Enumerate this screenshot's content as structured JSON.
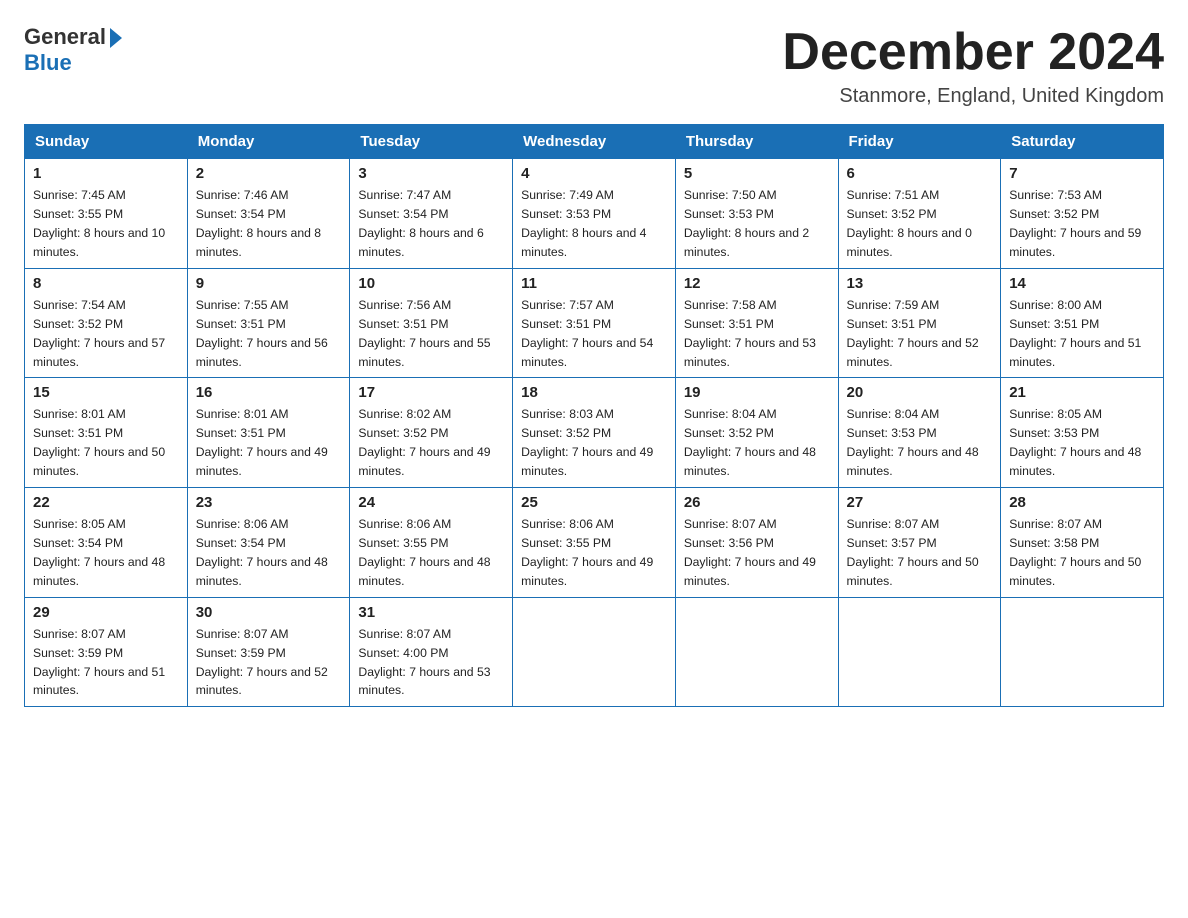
{
  "header": {
    "logo_general": "General",
    "logo_blue": "Blue",
    "title": "December 2024",
    "location": "Stanmore, England, United Kingdom"
  },
  "weekdays": [
    "Sunday",
    "Monday",
    "Tuesday",
    "Wednesday",
    "Thursday",
    "Friday",
    "Saturday"
  ],
  "weeks": [
    [
      {
        "day": "1",
        "sunrise": "7:45 AM",
        "sunset": "3:55 PM",
        "daylight": "8 hours and 10 minutes."
      },
      {
        "day": "2",
        "sunrise": "7:46 AM",
        "sunset": "3:54 PM",
        "daylight": "8 hours and 8 minutes."
      },
      {
        "day": "3",
        "sunrise": "7:47 AM",
        "sunset": "3:54 PM",
        "daylight": "8 hours and 6 minutes."
      },
      {
        "day": "4",
        "sunrise": "7:49 AM",
        "sunset": "3:53 PM",
        "daylight": "8 hours and 4 minutes."
      },
      {
        "day": "5",
        "sunrise": "7:50 AM",
        "sunset": "3:53 PM",
        "daylight": "8 hours and 2 minutes."
      },
      {
        "day": "6",
        "sunrise": "7:51 AM",
        "sunset": "3:52 PM",
        "daylight": "8 hours and 0 minutes."
      },
      {
        "day": "7",
        "sunrise": "7:53 AM",
        "sunset": "3:52 PM",
        "daylight": "7 hours and 59 minutes."
      }
    ],
    [
      {
        "day": "8",
        "sunrise": "7:54 AM",
        "sunset": "3:52 PM",
        "daylight": "7 hours and 57 minutes."
      },
      {
        "day": "9",
        "sunrise": "7:55 AM",
        "sunset": "3:51 PM",
        "daylight": "7 hours and 56 minutes."
      },
      {
        "day": "10",
        "sunrise": "7:56 AM",
        "sunset": "3:51 PM",
        "daylight": "7 hours and 55 minutes."
      },
      {
        "day": "11",
        "sunrise": "7:57 AM",
        "sunset": "3:51 PM",
        "daylight": "7 hours and 54 minutes."
      },
      {
        "day": "12",
        "sunrise": "7:58 AM",
        "sunset": "3:51 PM",
        "daylight": "7 hours and 53 minutes."
      },
      {
        "day": "13",
        "sunrise": "7:59 AM",
        "sunset": "3:51 PM",
        "daylight": "7 hours and 52 minutes."
      },
      {
        "day": "14",
        "sunrise": "8:00 AM",
        "sunset": "3:51 PM",
        "daylight": "7 hours and 51 minutes."
      }
    ],
    [
      {
        "day": "15",
        "sunrise": "8:01 AM",
        "sunset": "3:51 PM",
        "daylight": "7 hours and 50 minutes."
      },
      {
        "day": "16",
        "sunrise": "8:01 AM",
        "sunset": "3:51 PM",
        "daylight": "7 hours and 49 minutes."
      },
      {
        "day": "17",
        "sunrise": "8:02 AM",
        "sunset": "3:52 PM",
        "daylight": "7 hours and 49 minutes."
      },
      {
        "day": "18",
        "sunrise": "8:03 AM",
        "sunset": "3:52 PM",
        "daylight": "7 hours and 49 minutes."
      },
      {
        "day": "19",
        "sunrise": "8:04 AM",
        "sunset": "3:52 PM",
        "daylight": "7 hours and 48 minutes."
      },
      {
        "day": "20",
        "sunrise": "8:04 AM",
        "sunset": "3:53 PM",
        "daylight": "7 hours and 48 minutes."
      },
      {
        "day": "21",
        "sunrise": "8:05 AM",
        "sunset": "3:53 PM",
        "daylight": "7 hours and 48 minutes."
      }
    ],
    [
      {
        "day": "22",
        "sunrise": "8:05 AM",
        "sunset": "3:54 PM",
        "daylight": "7 hours and 48 minutes."
      },
      {
        "day": "23",
        "sunrise": "8:06 AM",
        "sunset": "3:54 PM",
        "daylight": "7 hours and 48 minutes."
      },
      {
        "day": "24",
        "sunrise": "8:06 AM",
        "sunset": "3:55 PM",
        "daylight": "7 hours and 48 minutes."
      },
      {
        "day": "25",
        "sunrise": "8:06 AM",
        "sunset": "3:55 PM",
        "daylight": "7 hours and 49 minutes."
      },
      {
        "day": "26",
        "sunrise": "8:07 AM",
        "sunset": "3:56 PM",
        "daylight": "7 hours and 49 minutes."
      },
      {
        "day": "27",
        "sunrise": "8:07 AM",
        "sunset": "3:57 PM",
        "daylight": "7 hours and 50 minutes."
      },
      {
        "day": "28",
        "sunrise": "8:07 AM",
        "sunset": "3:58 PM",
        "daylight": "7 hours and 50 minutes."
      }
    ],
    [
      {
        "day": "29",
        "sunrise": "8:07 AM",
        "sunset": "3:59 PM",
        "daylight": "7 hours and 51 minutes."
      },
      {
        "day": "30",
        "sunrise": "8:07 AM",
        "sunset": "3:59 PM",
        "daylight": "7 hours and 52 minutes."
      },
      {
        "day": "31",
        "sunrise": "8:07 AM",
        "sunset": "4:00 PM",
        "daylight": "7 hours and 53 minutes."
      },
      null,
      null,
      null,
      null
    ]
  ],
  "labels": {
    "sunrise": "Sunrise:",
    "sunset": "Sunset:",
    "daylight": "Daylight:"
  }
}
